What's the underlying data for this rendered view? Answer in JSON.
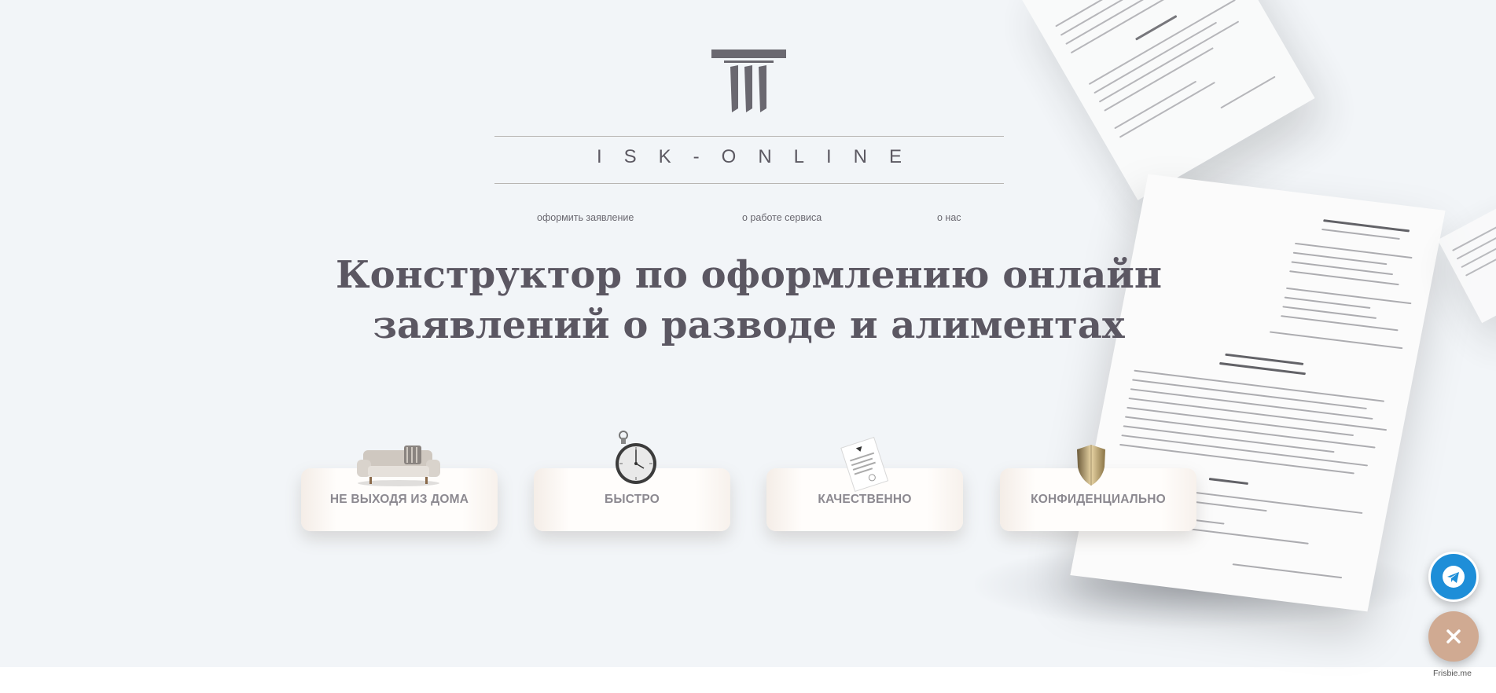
{
  "brand": {
    "name": "ISK-ONLINE"
  },
  "nav": [
    {
      "label": "оформить заявление"
    },
    {
      "label": "о работе сервиса"
    },
    {
      "label": "о нас"
    }
  ],
  "headline": {
    "line1": "Конструктор по оформлению онлайн",
    "line2": "заявлений о разводе и алиментах"
  },
  "features": [
    {
      "label": "НЕ ВЫХОДЯ ИЗ ДОМА",
      "icon": "sofa-icon"
    },
    {
      "label": "БЫСТРО",
      "icon": "stopwatch-icon"
    },
    {
      "label": "КАЧЕСТВЕННО",
      "icon": "document-icon"
    },
    {
      "label": "КОНФИДЕНЦИАЛЬНО",
      "icon": "shield-icon"
    }
  ],
  "widget": {
    "telegram_icon": "telegram-icon",
    "close_icon": "close-icon",
    "credit": "Frisbie.me"
  },
  "colors": {
    "background": "#f2f5f8",
    "heading": "#5b5762",
    "card_text": "#8c8990",
    "telegram": "#1e8ed8",
    "close": "#d0aa92"
  }
}
